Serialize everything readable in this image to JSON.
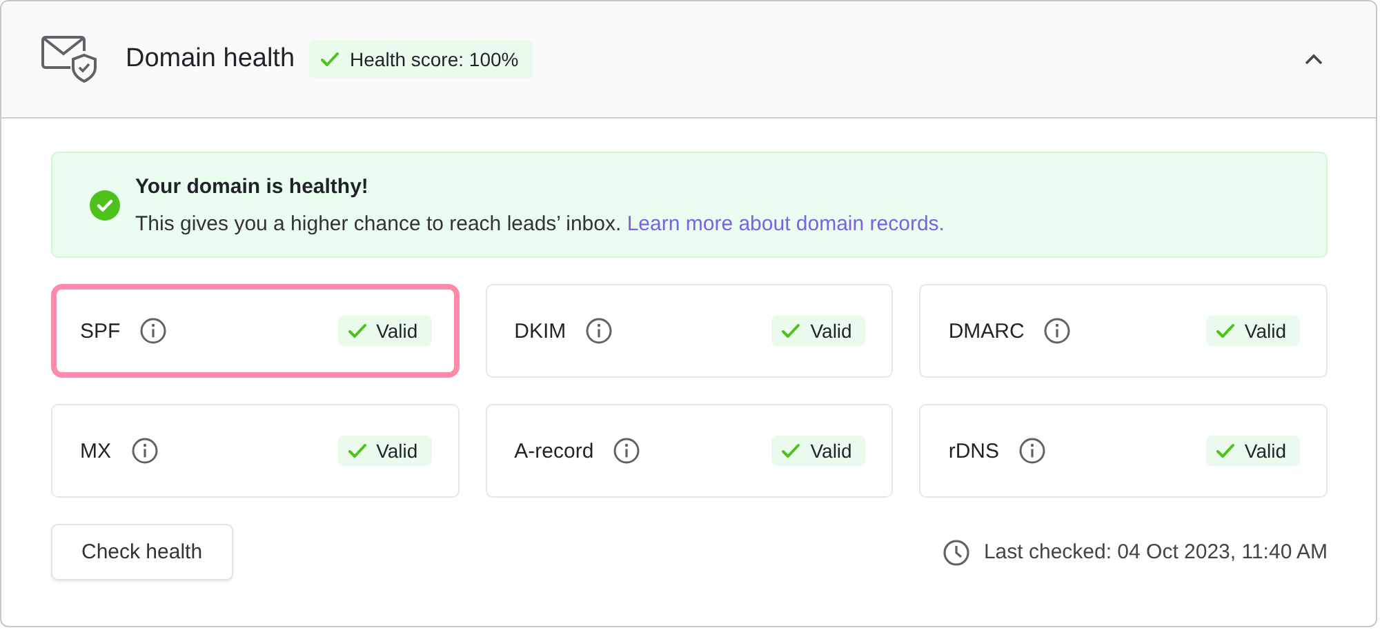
{
  "header": {
    "title": "Domain health",
    "score_badge": "Health score: 100%",
    "expanded": true
  },
  "banner": {
    "title": "Your domain is healthy!",
    "text": "This gives you a higher chance to reach leads’ inbox.",
    "link": "Learn more about domain records."
  },
  "records": [
    {
      "name": "SPF",
      "status": "Valid",
      "selected": true
    },
    {
      "name": "DKIM",
      "status": "Valid",
      "selected": false
    },
    {
      "name": "DMARC",
      "status": "Valid",
      "selected": false
    },
    {
      "name": "MX",
      "status": "Valid",
      "selected": false
    },
    {
      "name": "A-record",
      "status": "Valid",
      "selected": false
    },
    {
      "name": "rDNS",
      "status": "Valid",
      "selected": false
    }
  ],
  "check_button": "Check health",
  "last_checked": "Last checked: 04 Oct 2023, 11:40 AM"
}
